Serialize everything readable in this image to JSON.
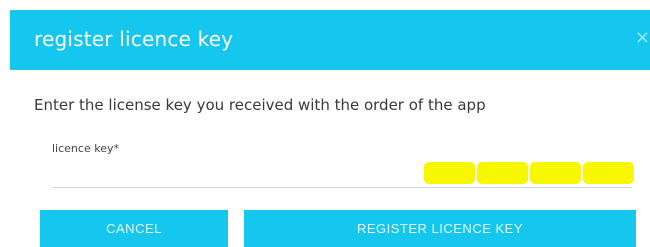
{
  "header": {
    "title": "register licence key",
    "close_glyph": "×",
    "background": "#15c6ef"
  },
  "body": {
    "instructions": "Enter the license key you received with the order of the app",
    "field_label": "licence key*",
    "redacted_color": "#f7f700"
  },
  "buttons": {
    "cancel_label": "CANCEL",
    "register_label": "REGISTER LICENCE KEY"
  }
}
